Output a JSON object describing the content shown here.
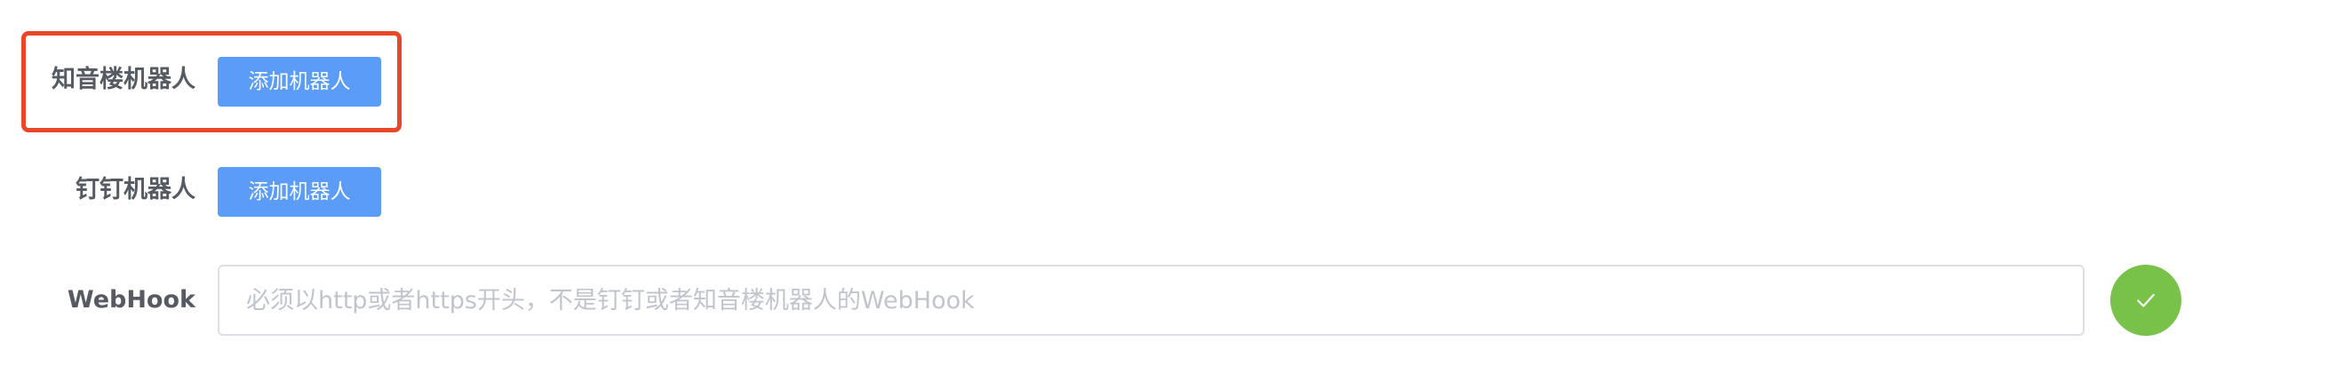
{
  "rows": [
    {
      "label": "知音楼机器人",
      "button_label": "添加机器人"
    },
    {
      "label": "钉钉机器人",
      "button_label": "添加机器人"
    }
  ],
  "webhook": {
    "label": "WebHook",
    "value": "",
    "placeholder": "必须以http或者https开头，不是钉钉或者知音楼机器人的WebHook"
  },
  "confirm_button": {
    "icon": "check-icon"
  },
  "colors": {
    "primary_button": "#5a9cf8",
    "confirm_button": "#78c24a",
    "highlight_border": "#e8472a",
    "label_text": "#555a63"
  }
}
